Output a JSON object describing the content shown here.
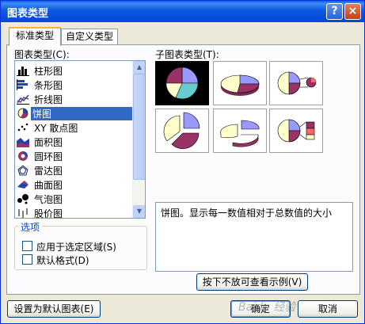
{
  "window": {
    "title": "图表类型",
    "help_glyph": "?",
    "close_glyph": "×"
  },
  "tabs": [
    {
      "label": "标准类型",
      "active": true
    },
    {
      "label": "自定义类型",
      "active": false
    }
  ],
  "chart_type_list": {
    "label": "图表类型(C):",
    "items": [
      {
        "label": "柱形图",
        "icon": "column-chart-icon"
      },
      {
        "label": "条形图",
        "icon": "bar-chart-icon"
      },
      {
        "label": "折线图",
        "icon": "line-chart-icon"
      },
      {
        "label": "饼图",
        "icon": "pie-chart-icon",
        "selected": true
      },
      {
        "label": "XY 散点图",
        "icon": "scatter-chart-icon"
      },
      {
        "label": "面积图",
        "icon": "area-chart-icon"
      },
      {
        "label": "圆环图",
        "icon": "doughnut-chart-icon"
      },
      {
        "label": "雷达图",
        "icon": "radar-chart-icon"
      },
      {
        "label": "曲面图",
        "icon": "surface-chart-icon"
      },
      {
        "label": "气泡图",
        "icon": "bubble-chart-icon"
      },
      {
        "label": "股价图",
        "icon": "stock-chart-icon"
      }
    ]
  },
  "subtype": {
    "label": "子图表类型(T):",
    "description": "饼图。显示每一数值相对于总数值的大小"
  },
  "options": {
    "title": "选项",
    "apply_to_selection": "应用于选定区域(S)",
    "default_format": "默认格式(D)"
  },
  "buttons": {
    "preview": "按下不放可查看示例(V)",
    "set_default": "设置为默认图表(E)",
    "ok": "确定",
    "cancel": "取消"
  },
  "watermark": "Baidu 经验",
  "colors": {
    "title_bar": "#0b58e3",
    "selection": "#316ac5",
    "pie_yellow": "#ffffcc",
    "pie_purple": "#993366",
    "pie_blue": "#9999ff",
    "pie_teal": "#66cccc"
  }
}
